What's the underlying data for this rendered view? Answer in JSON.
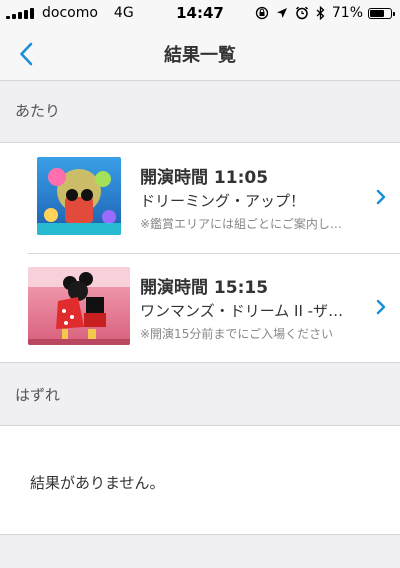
{
  "status_bar": {
    "carrier": "docomo",
    "network": "4G",
    "time": "14:47",
    "battery_percent_text": "71%",
    "battery_level": 0.71,
    "icons": [
      "signal-icon",
      "rotation-lock-icon",
      "location-icon",
      "alarm-icon",
      "bluetooth-icon",
      "battery-icon"
    ]
  },
  "nav": {
    "back_icon": "chevron-left-icon",
    "title": "結果一覧"
  },
  "sections": {
    "hit": {
      "header": "あたり",
      "items": [
        {
          "time": "開演時間 11:05",
          "title": "ドリーミング・アップ！",
          "note": "※鑑賞エリアには組ごとにご案内します"
        },
        {
          "time": "開演時間 15:15",
          "title": "ワンマンズ・ドリーム II ‐ザ・マジック・リブズ・オン",
          "note": "※開演15分前までにご入場ください"
        }
      ]
    },
    "miss": {
      "header": "はずれ",
      "empty_text": "結果がありません。"
    }
  },
  "colors": {
    "accent": "#1a8fd6",
    "background": "#efeff4"
  }
}
